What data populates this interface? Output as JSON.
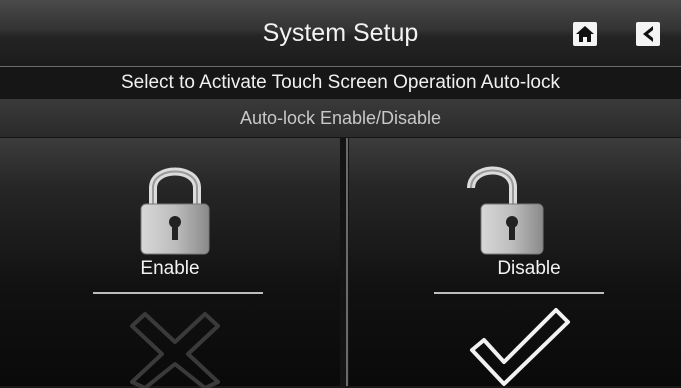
{
  "header": {
    "title": "System Setup",
    "home_icon": "home-icon",
    "back_icon": "back-arrow-icon"
  },
  "instruction": "Select to Activate Touch Screen Operation Auto-lock",
  "subtitle": "Auto-lock Enable/Disable",
  "options": [
    {
      "label": "Enable",
      "icon": "locked-padlock-icon",
      "selected": false,
      "mark": "cross-icon"
    },
    {
      "label": "Disable",
      "icon": "unlocked-padlock-icon",
      "selected": true,
      "mark": "checkmark-icon"
    }
  ],
  "colors": {
    "background": "#141414",
    "text": "#f2f2f2",
    "subtitle_text": "#c8c8c8",
    "separator": "#6a6a6a"
  }
}
